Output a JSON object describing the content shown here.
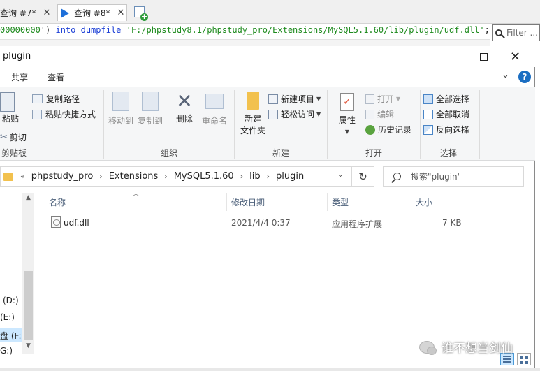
{
  "editor": {
    "tabs": [
      {
        "label": "查询 #7*",
        "close": "✕"
      },
      {
        "label": "查询 #8*",
        "close": "✕"
      }
    ],
    "sql": {
      "num": "00000000",
      "punc": "')",
      "keyword": "into dumpfile",
      "string": "'F:/phpstudy8.1/phpstudy_pro/Extensions/MySQL5.1.60/lib/plugin/udf.dll'",
      "end": ";"
    },
    "filter_placeholder": "Filter ..."
  },
  "window": {
    "title": "plugin",
    "minimize": "—",
    "maximize": "☐",
    "close": "✕"
  },
  "menu": {
    "share": "共享",
    "view": "查看",
    "chevron": "⌄",
    "help": "?"
  },
  "ribbon": {
    "clipboard": {
      "label": "剪贴板",
      "paste": "粘贴",
      "copy_path": "复制路径",
      "paste_shortcut": "粘贴快捷方式",
      "cut": "剪切"
    },
    "organize": {
      "label": "组织",
      "move_to": "移动到",
      "copy_to": "复制到",
      "delete": "删除",
      "rename": "重命名"
    },
    "new": {
      "label": "新建",
      "new_folder_1": "新建",
      "new_folder_2": "文件夹",
      "new_item": "新建项目",
      "easy_access": "轻松访问"
    },
    "open": {
      "label": "打开",
      "properties": "属性",
      "open": "打开",
      "edit": "编辑",
      "history": "历史记录"
    },
    "select": {
      "label": "选择",
      "select_all": "全部选择",
      "select_none": "全部取消",
      "invert": "反向选择"
    }
  },
  "address": {
    "crumbs": [
      "phpstudy_pro",
      "Extensions",
      "MySQL5.1.60",
      "lib",
      "plugin"
    ],
    "prefix": "«",
    "sep": "›",
    "refresh": "↻",
    "search_placeholder": "搜索\"plugin\""
  },
  "nav": {
    "drives": [
      "(D:)",
      "(E:)",
      "盘 (F:)",
      "G:)"
    ]
  },
  "columns": {
    "name": "名称",
    "modified": "修改日期",
    "type": "类型",
    "size": "大小"
  },
  "files": [
    {
      "name": "udf.dll",
      "modified": "2021/4/4 0:37",
      "type": "应用程序扩展",
      "size": "7 KB"
    }
  ],
  "watermark": {
    "text": "谁不想当剑仙"
  },
  "colors": {
    "accent": "#1b6ec2",
    "selection": "#cce8ff",
    "sql_keyword": "#1c3fd6",
    "sql_string": "#1d8a1d"
  }
}
